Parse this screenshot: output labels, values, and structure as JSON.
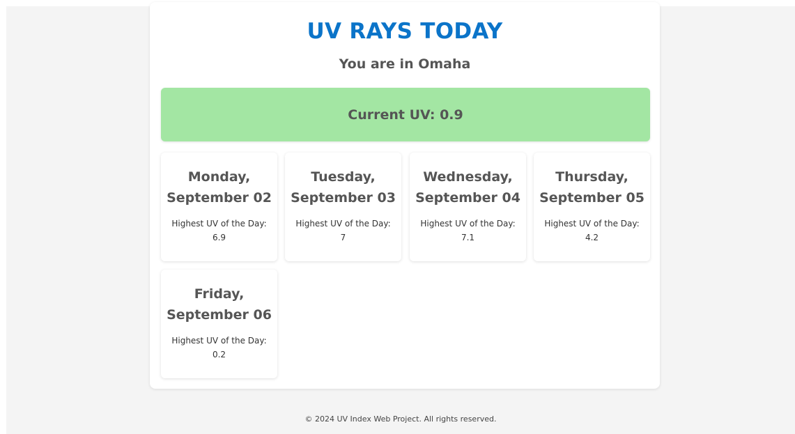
{
  "header": {
    "title": "UV RAYS TODAY",
    "location": "You are in Omaha"
  },
  "current": {
    "label": "Current UV: 0.9"
  },
  "forecast": [
    {
      "day": "Monday, September 02",
      "uv_text": "Highest UV of the Day: 6.9"
    },
    {
      "day": "Tuesday, September 03",
      "uv_text": "Highest UV of the Day: 7"
    },
    {
      "day": "Wednesday, September 04",
      "uv_text": "Highest UV of the Day: 7.1"
    },
    {
      "day": "Thursday, September 05",
      "uv_text": "Highest UV of the Day: 4.2"
    },
    {
      "day": "Friday, September 06",
      "uv_text": "Highest UV of the Day: 0.2"
    }
  ],
  "footer": {
    "text": "© 2024 UV Index Web Project. All rights reserved."
  },
  "colors": {
    "title": "#0b74c9",
    "current_uv_background": "#a3e6a3",
    "page_background": "#f4f4f4",
    "card_background": "#ffffff"
  }
}
